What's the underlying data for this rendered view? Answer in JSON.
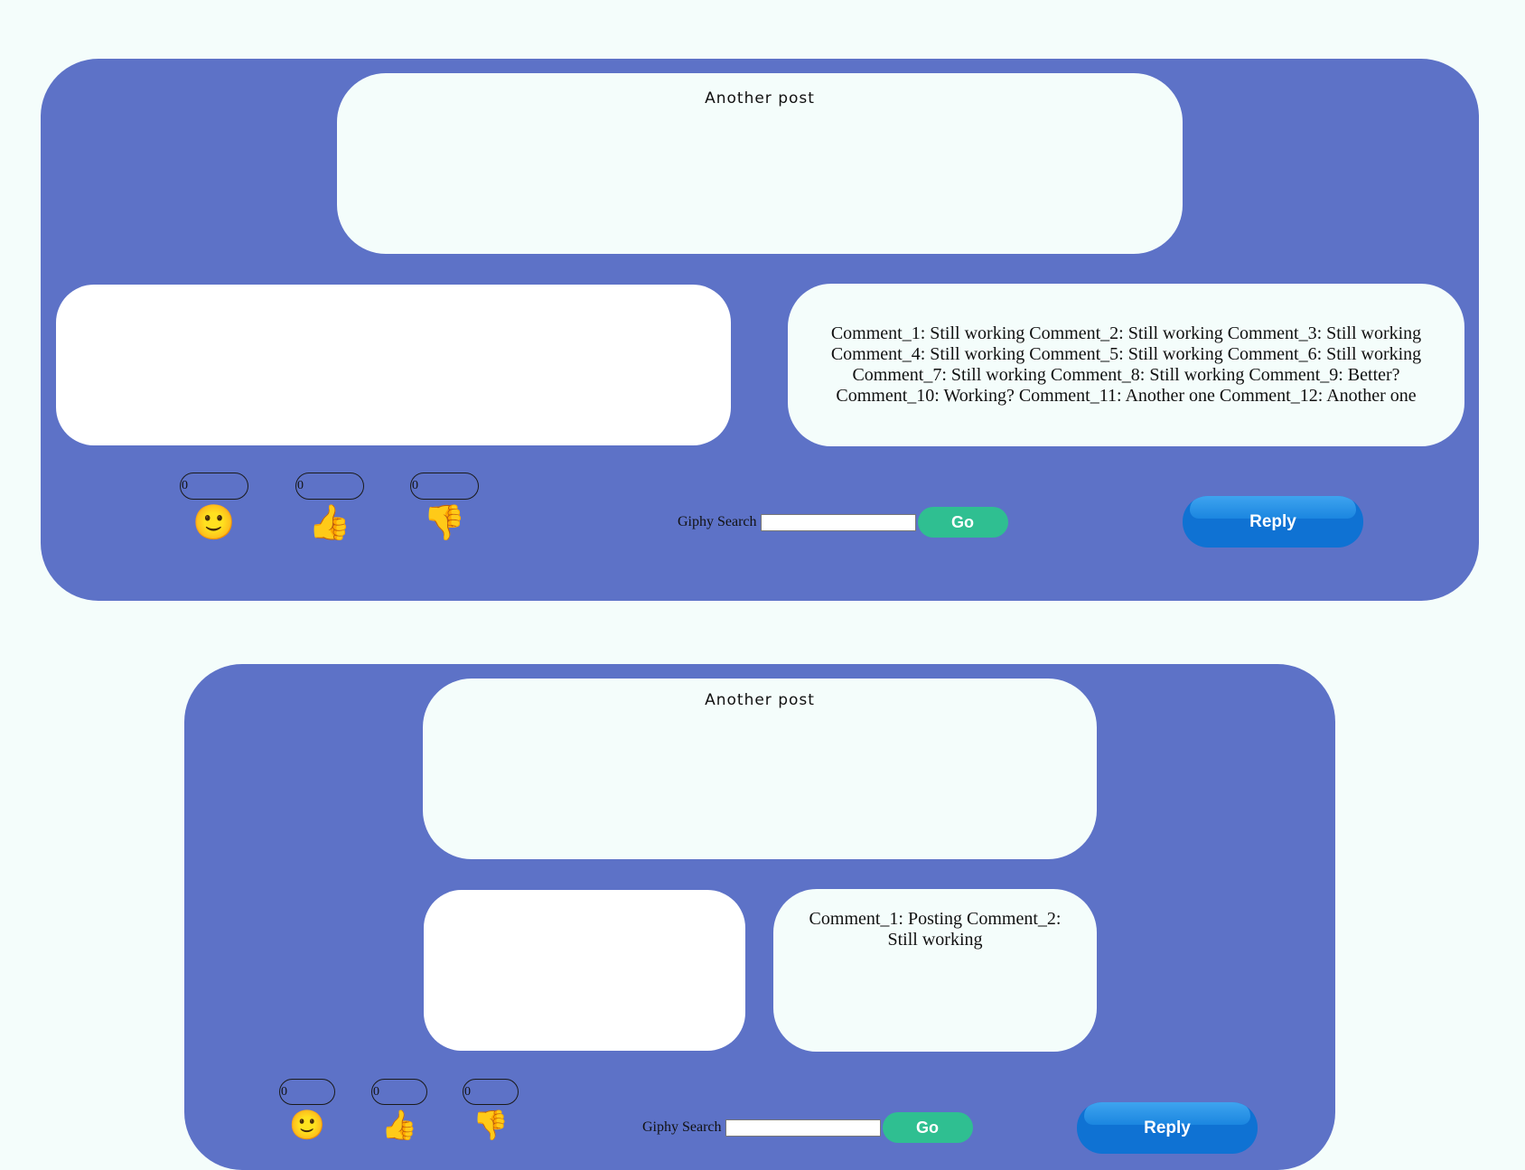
{
  "posts": [
    {
      "title": "Another post",
      "comments": "Comment_1: Still working Comment_2: Still working Comment_3: Still working Comment_4: Still working Comment_5: Still working Comment_6: Still working Comment_7: Still working Comment_8: Still working Comment_9: Better? Comment_10: Working? Comment_11: Another one Comment_12: Another one",
      "reactions": [
        {
          "icon": "smiley-face-icon",
          "glyph": "🙂",
          "count": "0"
        },
        {
          "icon": "thumbs-up-icon",
          "glyph": "👍",
          "count": "0"
        },
        {
          "icon": "thumbs-down-icon",
          "glyph": "👎",
          "count": "0"
        }
      ],
      "giphy_label": "Giphy Search",
      "giphy_value": "",
      "go_label": "Go",
      "reply_label": "Reply"
    },
    {
      "title": "Another post",
      "comments": "Comment_1: Posting Comment_2: Still working",
      "reactions": [
        {
          "icon": "smiley-face-icon",
          "glyph": "🙂",
          "count": "0"
        },
        {
          "icon": "thumbs-up-icon",
          "glyph": "👍",
          "count": "0"
        },
        {
          "icon": "thumbs-down-icon",
          "glyph": "👎",
          "count": "0"
        }
      ],
      "giphy_label": "Giphy Search",
      "giphy_value": "",
      "go_label": "Go",
      "reply_label": "Reply"
    }
  ],
  "colors": {
    "page_background": "#f4fdfb",
    "post_background": "#5d72c7",
    "go_button": "#2fbf91",
    "reply_button": "#0f72d3"
  }
}
